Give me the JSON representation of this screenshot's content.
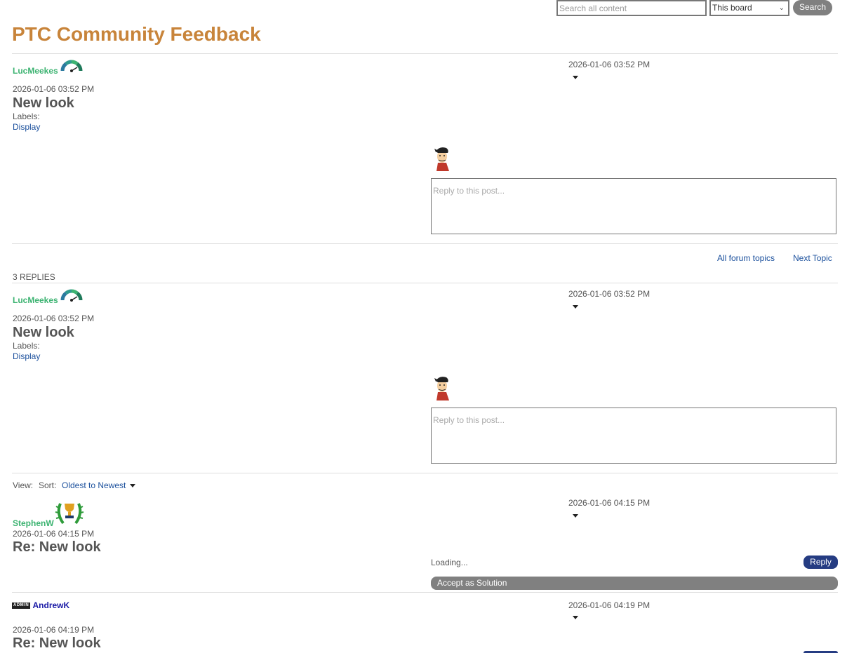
{
  "search": {
    "placeholder": "Search all content",
    "scope_selected": "This board",
    "button_label": "Search"
  },
  "page_title": "PTC Community Feedback",
  "topic_post": {
    "author": "LucMeekes",
    "header_date": "2026-01-06 03:52 PM",
    "date": "2026-01-06 03:52 PM",
    "title": "New look",
    "labels_caption": "Labels:",
    "label": "Display",
    "reply_placeholder": "Reply to this post..."
  },
  "topic_nav": {
    "all_topics": "All forum topics",
    "next_topic": "Next Topic"
  },
  "replies_count": "3 REPLIES",
  "quoted_post": {
    "author": "LucMeekes",
    "header_date": "2026-01-06 03:52 PM",
    "date": "2026-01-06 03:52 PM",
    "title": "New look",
    "labels_caption": "Labels:",
    "label": "Display",
    "reply_placeholder": "Reply to this post..."
  },
  "sort_bar": {
    "view_label": "View:",
    "sort_label": "Sort:",
    "sort_value": "Oldest to Newest"
  },
  "reply_1": {
    "author": "StephenW",
    "header_date": "2026-01-06 04:15 PM",
    "date": "2026-01-06 04:15 PM",
    "title": "Re: New look",
    "loading": "Loading...",
    "reply_button": "Reply",
    "accept_button": "Accept as Solution"
  },
  "reply_2": {
    "badge": "ADMIN",
    "author": "AndrewK",
    "header_date": "2026-01-06 04:19 PM",
    "date": "2026-01-06 04:19 PM",
    "title": "Re: New look"
  },
  "colors": {
    "title": "#c8843a",
    "username": "#3cb371",
    "admin_name": "#1a1aa6",
    "link": "#1a4f9c",
    "reply_button": "#253c82",
    "gray_button": "#808080"
  },
  "icons": [
    "rank-gauge-icon",
    "trophy-wreath-icon",
    "user-avatar-icon",
    "caret-down-icon"
  ]
}
